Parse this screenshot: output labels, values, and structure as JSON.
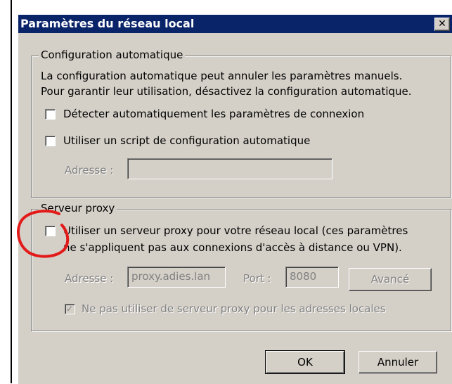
{
  "dialog": {
    "title": "Paramètres du réseau local",
    "close_glyph": "✕"
  },
  "auto_config": {
    "legend": "Configuration automatique",
    "description_line1": "La configuration automatique peut annuler les paramètres manuels.",
    "description_line2": "Pour garantir leur utilisation, désactivez la configuration automatique.",
    "detect_label": "Détecter automatiquement les paramètres de connexion",
    "detect_checked": false,
    "script_label": "Utiliser un script de configuration automatique",
    "script_checked": false,
    "address_label": "Adresse :",
    "address_value": ""
  },
  "proxy": {
    "legend": "Serveur proxy",
    "use_proxy_line1": "Utiliser un serveur proxy pour votre réseau local (ces paramètres",
    "use_proxy_line2": "ne s'appliquent pas aux connexions d'accès à distance ou VPN).",
    "use_proxy_checked": false,
    "address_label": "Adresse :",
    "address_value": "proxy.adies.lan",
    "port_label": "Port :",
    "port_value": "8080",
    "advanced_label": "Avancé",
    "bypass_label": "Ne pas utiliser de serveur proxy pour les adresses locales",
    "bypass_checked": true
  },
  "buttons": {
    "ok": "OK",
    "cancel": "Annuler"
  },
  "colors": {
    "titlebar": "#0a246a",
    "dialog_bg": "#d4d0c8",
    "annotation_circle": "#e31a1a"
  }
}
